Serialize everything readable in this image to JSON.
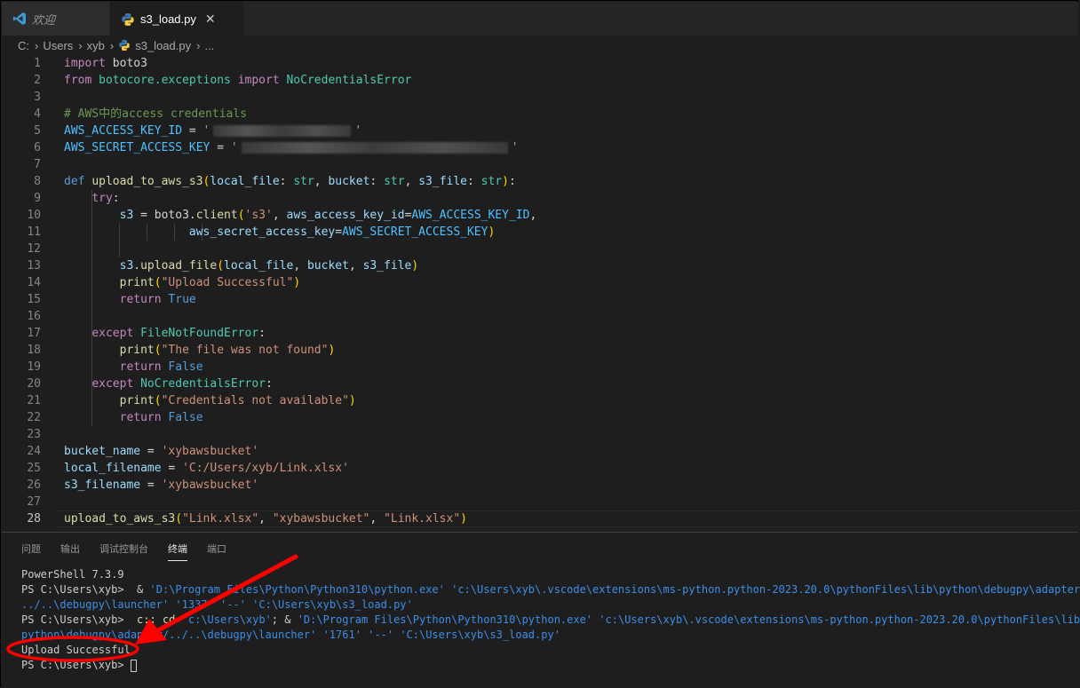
{
  "tabs": [
    {
      "label": "欢迎",
      "icon": "vscode-icon"
    },
    {
      "label": "s3_load.py",
      "icon": "python-icon",
      "close": "✕"
    }
  ],
  "breadcrumb": [
    "C:",
    "Users",
    "xyb",
    "s3_load.py",
    "..."
  ],
  "code": {
    "ln": [
      "1",
      "2",
      "3",
      "4",
      "5",
      "6",
      "7",
      "8",
      "9",
      "10",
      "11",
      "12",
      "13",
      "14",
      "15",
      "16",
      "17",
      "18",
      "19",
      "20",
      "21",
      "22",
      "23",
      "24",
      "25",
      "26",
      "27",
      "28"
    ],
    "l1": {
      "k": "import",
      "r": " boto3"
    },
    "l2": {
      "k1": "from",
      "m": " botocore.exceptions ",
      "k2": "import",
      "c": " NoCredentialsError"
    },
    "l4": {
      "t": "# AWS中的access credentials"
    },
    "l5": {
      "v": "AWS_ACCESS_KEY_ID",
      "eq": " = ",
      "q1": "'",
      "q2": "'"
    },
    "l6": {
      "v": "AWS_SECRET_ACCESS_KEY",
      "eq": " = ",
      "q1": "'",
      "q2": "'"
    },
    "l8": {
      "def": "def",
      "fn": "upload_to_aws_s3",
      "p1": "local_file",
      "t1": "str",
      "p2": "bucket",
      "t2": "str",
      "p3": "s3_file",
      "t3": "str"
    },
    "l9": {
      "k": "try"
    },
    "l10": {
      "v": "s3",
      "m": " = boto3.",
      "fn": "client",
      "s": "'s3'",
      "kw": "aws_access_key_id",
      "c": "AWS_ACCESS_KEY_ID"
    },
    "l11": {
      "kw": "aws_secret_access_key",
      "c": "AWS_SECRET_ACCESS_KEY"
    },
    "l13": {
      "v": "s3",
      "fn": "upload_file",
      "a1": "local_file",
      "a2": "bucket",
      "a3": "s3_file"
    },
    "l14": {
      "fn": "print",
      "s": "\"Upload Successful\""
    },
    "l15": {
      "k": "return",
      "c": "True"
    },
    "l17": {
      "k": "except",
      "ty": "FileNotFoundError"
    },
    "l18": {
      "fn": "print",
      "s": "\"The file was not found\""
    },
    "l19": {
      "k": "return",
      "c": "False"
    },
    "l20": {
      "k": "except",
      "ty": "NoCredentialsError"
    },
    "l21": {
      "fn": "print",
      "s": "\"Credentials not available\""
    },
    "l22": {
      "k": "return",
      "c": "False"
    },
    "l24": {
      "v": "bucket_name",
      "s": "'xybawsbucket'"
    },
    "l25": {
      "v": "local_filename",
      "s": "'C:/Users/xyb/Link.xlsx'"
    },
    "l26": {
      "v": "s3_filename",
      "s": "'xybawsbucket'"
    },
    "l28": {
      "fn": "upload_to_aws_s3",
      "s1": "\"Link.xlsx\"",
      "s2": "\"xybawsbucket\"",
      "s3": "\"Link.xlsx\""
    }
  },
  "panel_tabs": [
    "问题",
    "输出",
    "调试控制台",
    "终端",
    "端口"
  ],
  "panel_active": "终端",
  "terminal": {
    "banner": "PowerShell 7.3.9",
    "prompt": "PS C:\\Users\\xyb> ",
    "cmd1_pre": " & ",
    "cmd1_s1": "'D:\\Program Files\\Python\\Python310\\python.exe'",
    "cmd1_s2": "'c:\\Users\\xyb\\.vscode\\extensions\\ms-python.python-2023.20.0\\pythonFiles\\lib\\python\\debugpy\\adapter/",
    "cmd1_s3": "../..\\debugpy\\launcher'",
    "cmd1_s4": "'1337'",
    "cmd1_s5": "'--'",
    "cmd1_s6": "'C:\\Users\\xyb\\s3_load.py'",
    "cmd2_pre": " c:; ",
    "cmd2_cd": "cd",
    "cmd2_s0": "'c:\\Users\\xyb'",
    "cmd2_s1": "'D:\\Program Files\\Python\\Python310\\python.exe'",
    "cmd2_s2": "'c:\\Users\\xyb\\.vscode\\extensions\\ms-python.python-2023.20.0\\pythonFiles\\lib\\",
    "cmd2_s3": "python\\debugpy\\adapter/../..\\debugpy\\launcher'",
    "cmd2_s4": "'1761'",
    "cmd2_s5": "'--'",
    "cmd2_s6": "'C:\\Users\\xyb\\s3_load.py'",
    "output": "Upload Successful",
    "prompt_last": "PS C:\\Users\\xyb> "
  },
  "colors": {
    "annotation": "#ff0000",
    "editor_bg": "#1e1e1e",
    "keyword": "#569cd6",
    "string": "#ce9178"
  }
}
